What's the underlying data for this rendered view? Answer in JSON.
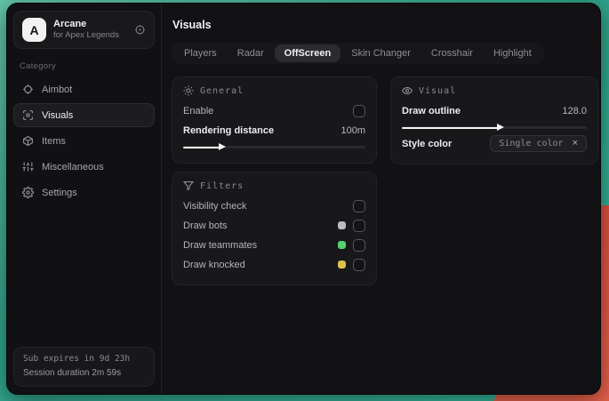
{
  "sidebar": {
    "app": {
      "initial": "A",
      "title": "Arcane",
      "subtitle": "for Apex Legends"
    },
    "category_label": "Category",
    "items": [
      {
        "label": "Aimbot",
        "icon": "crosshair-icon"
      },
      {
        "label": "Visuals",
        "icon": "eye-scan-icon"
      },
      {
        "label": "Items",
        "icon": "box-icon"
      },
      {
        "label": "Miscellaneous",
        "icon": "sliders-icon"
      },
      {
        "label": "Settings",
        "icon": "gear-icon"
      }
    ],
    "footer": {
      "line1": "Sub expires in 9d 23h",
      "line2": "Session duration 2m 59s"
    }
  },
  "main": {
    "title": "Visuals",
    "tabs": [
      {
        "label": "Players"
      },
      {
        "label": "Radar"
      },
      {
        "label": "OffScreen",
        "active": true
      },
      {
        "label": "Skin Changer"
      },
      {
        "label": "Crosshair"
      },
      {
        "label": "Highlight"
      }
    ],
    "general": {
      "title": "General",
      "enable_label": "Enable",
      "slider_label": "Rendering distance",
      "slider_value": "100m",
      "slider_percent": "20%"
    },
    "visual": {
      "title": "Visual",
      "slider_label": "Draw outline",
      "slider_value": "128.0",
      "slider_percent": "52%",
      "style_color_label": "Style color",
      "style_color_value": "Single color",
      "clear_icon": "×"
    },
    "filters": {
      "title": "Filters",
      "rows": [
        {
          "label": "Visibility check"
        },
        {
          "label": "Draw bots",
          "swatch": "#bcbcbe"
        },
        {
          "label": "Draw teammates",
          "swatch": "#55d36e"
        },
        {
          "label": "Draw knocked",
          "swatch": "#ddbf4b"
        }
      ]
    }
  },
  "colors": {
    "accent_teal": "#2fa189",
    "accent_red": "#df5440",
    "swatch_gray": "#bcbcbe",
    "swatch_green": "#55d36e",
    "swatch_yellow": "#ddbf4b"
  }
}
